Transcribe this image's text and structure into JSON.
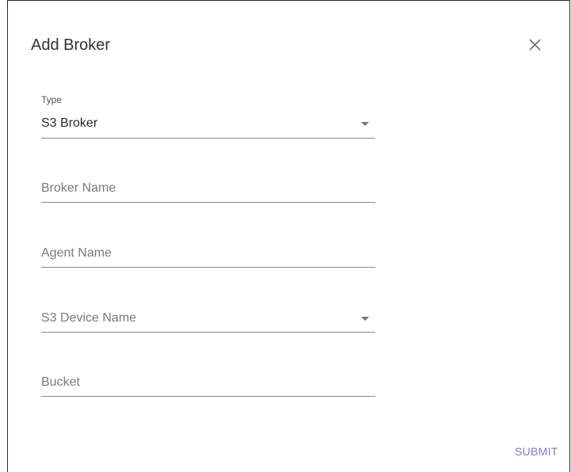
{
  "dialog": {
    "title": "Add Broker",
    "close_icon": "close-icon"
  },
  "form": {
    "type": {
      "label": "Type",
      "value": "S3 Broker",
      "icon": "caret-down-icon"
    },
    "broker_name": {
      "placeholder": "Broker Name"
    },
    "agent_name": {
      "placeholder": "Agent Name"
    },
    "s3_device_name": {
      "placeholder": "S3 Device Name",
      "icon": "caret-down-icon"
    },
    "bucket": {
      "placeholder": "Bucket"
    }
  },
  "actions": {
    "submit_label": "SUBMIT"
  },
  "colors": {
    "accent": "#7c7ad0",
    "underline": "#8a8a8a",
    "title_text": "#333333",
    "placeholder_text": "#7a7a7a"
  }
}
